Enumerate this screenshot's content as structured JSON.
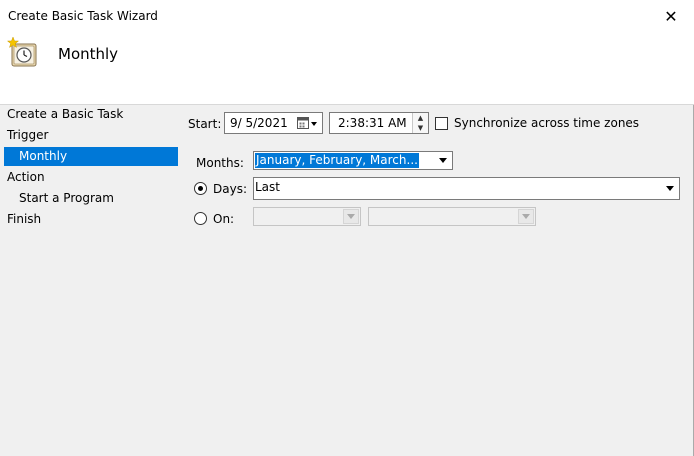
{
  "window": {
    "title": "Create Basic Task Wizard",
    "close_glyph": "✕"
  },
  "header": {
    "title": "Monthly",
    "icon": "task-scheduler-clock-icon"
  },
  "nav": {
    "items": [
      {
        "label": "Create a Basic Task",
        "selected": false
      },
      {
        "label": "Trigger",
        "selected": false
      },
      {
        "label": "Monthly",
        "selected": true
      },
      {
        "label": "Action",
        "selected": false
      },
      {
        "label": "Start a Program",
        "selected": false
      },
      {
        "label": "Finish",
        "selected": false
      }
    ]
  },
  "form": {
    "start_label": "Start:",
    "start_date": "9/  5/2021",
    "start_time": "2:38:31 AM",
    "sync_label": "Synchronize across time zones",
    "sync_checked": false,
    "months_label": "Months:",
    "months_value": "January, February, March...",
    "days_label": "Days:",
    "days_value": "Last",
    "days_selected": true,
    "on_label": "On:",
    "on_selected": false,
    "on_week_value": "",
    "on_day_value": ""
  },
  "colors": {
    "selection": "#0078d7",
    "background": "#f0f0f0"
  }
}
